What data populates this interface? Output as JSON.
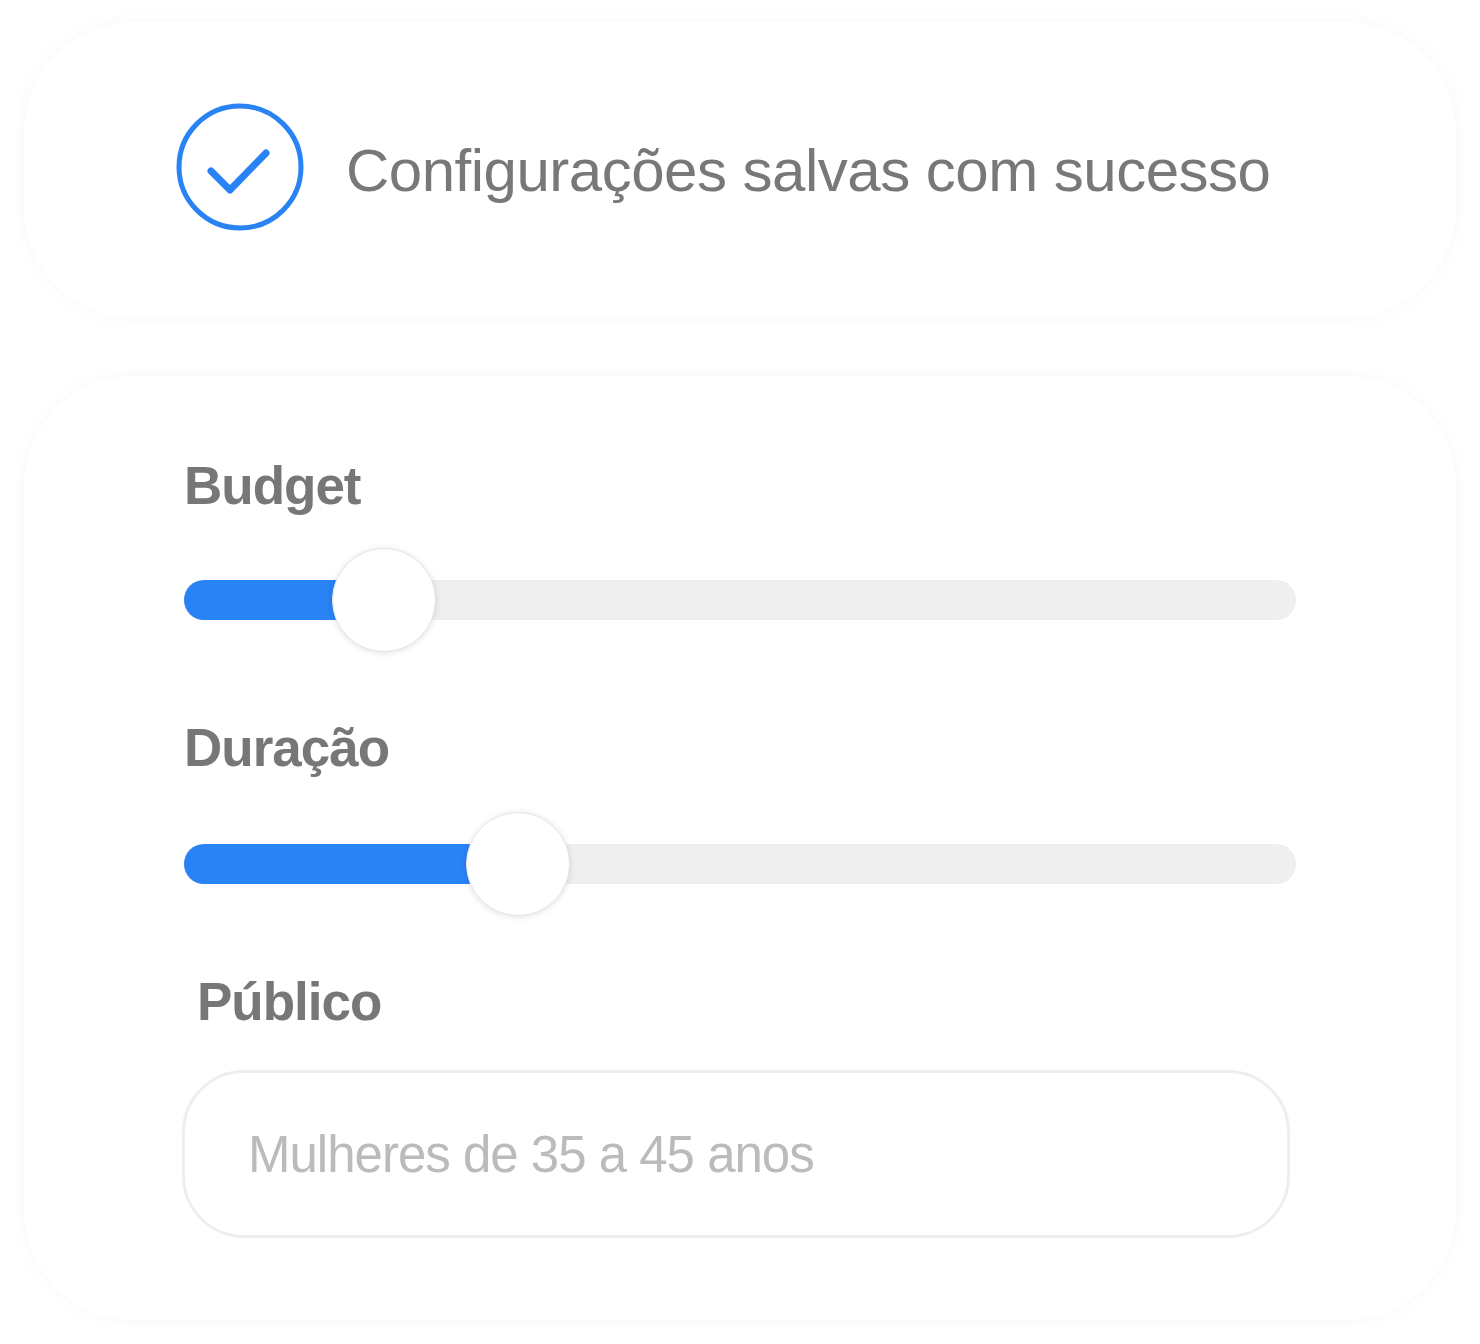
{
  "notification": {
    "kind": "success",
    "message": "Configurações salvas com sucesso"
  },
  "settings": {
    "sliders": [
      {
        "label": "Budget",
        "level": 0.18
      },
      {
        "label": "Duração",
        "level": 0.3
      }
    ],
    "audience": {
      "label": "Público",
      "placeholder": "Mulheres de 35 a 45 anos"
    }
  }
}
